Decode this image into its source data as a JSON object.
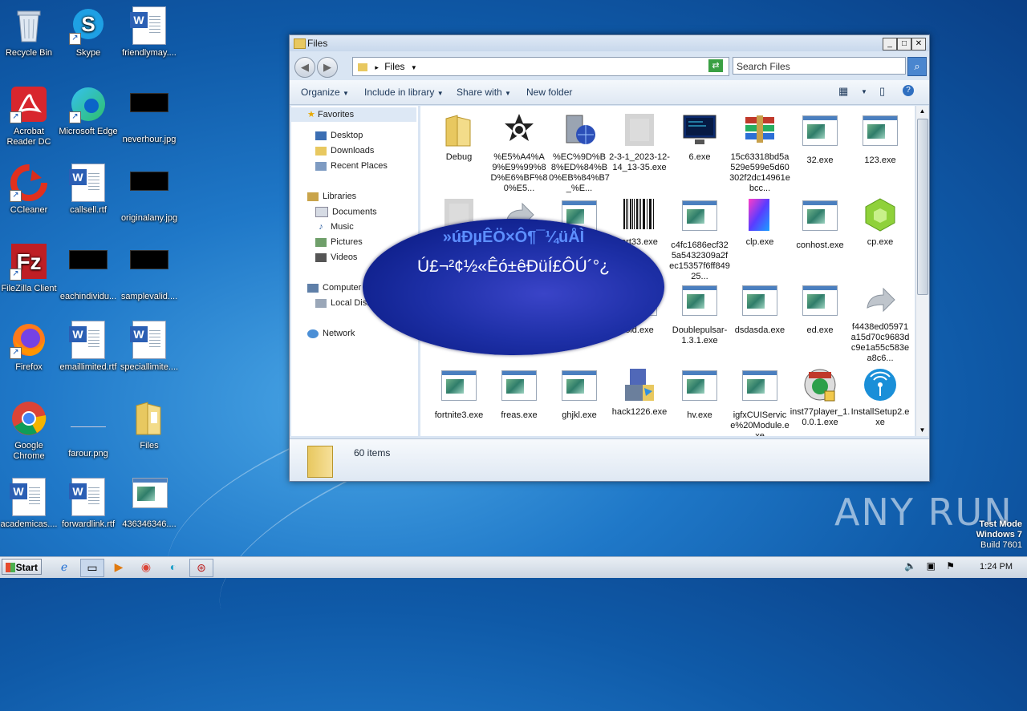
{
  "desktop": {
    "icons": [
      {
        "label": "Recycle Bin",
        "icon": "recycle-bin-icon"
      },
      {
        "label": "Skype",
        "icon": "skype-icon"
      },
      {
        "label": "friendlymay....",
        "icon": "word-doc-icon"
      },
      {
        "label": "Acrobat Reader DC",
        "icon": "acrobat-icon"
      },
      {
        "label": "Microsoft Edge",
        "icon": "edge-icon"
      },
      {
        "label": "neverhour.jpg",
        "icon": "image-file-icon"
      },
      {
        "label": "CCleaner",
        "icon": "ccleaner-icon"
      },
      {
        "label": "callsell.rtf",
        "icon": "word-doc-icon"
      },
      {
        "label": "originalany.jpg",
        "icon": "image-file-icon"
      },
      {
        "label": "FileZilla Client",
        "icon": "filezilla-icon"
      },
      {
        "label": "eachindividu...",
        "icon": "image-file-icon"
      },
      {
        "label": "samplevalid....",
        "icon": "image-file-icon"
      },
      {
        "label": "Firefox",
        "icon": "firefox-icon"
      },
      {
        "label": "emaillimited.rtf",
        "icon": "word-doc-icon"
      },
      {
        "label": "speciallimite....",
        "icon": "word-doc-icon"
      },
      {
        "label": "Google Chrome",
        "icon": "chrome-icon"
      },
      {
        "label": "farour.png",
        "icon": "image-file-icon"
      },
      {
        "label": "Files",
        "icon": "folder-icon"
      },
      {
        "label": "academicas....",
        "icon": "word-doc-icon"
      },
      {
        "label": "forwardlink.rtf",
        "icon": "word-doc-icon"
      },
      {
        "label": "436346346....",
        "icon": "exe-icon"
      }
    ]
  },
  "window": {
    "title": "Files",
    "address": "Files",
    "search_placeholder": "Search Files",
    "toolbar": {
      "organize": "Organize",
      "include": "Include in library",
      "share": "Share with",
      "new_folder": "New folder"
    },
    "nav": {
      "favorites": "Favorites",
      "desktop": "Desktop",
      "downloads": "Downloads",
      "recent": "Recent Places",
      "libraries": "Libraries",
      "documents": "Documents",
      "music": "Music",
      "pictures": "Pictures",
      "videos": "Videos",
      "homegroup": "Homegroup",
      "computer": "Computer",
      "local_disk": "Local Disk (C:)",
      "network": "Network"
    },
    "files": [
      {
        "name": "Debug",
        "icon": "folder-icon"
      },
      {
        "name": "%E5%A4%A9%E9%99%8D%E6%BF%80%E5...",
        "icon": "badge-icon"
      },
      {
        "name": "%EC%9D%B8%ED%84%B0%EB%84%B7_%E...",
        "icon": "globe-server-icon"
      },
      {
        "name": "2-3-1_2023-12-14_13-35.exe",
        "icon": "blurred-icon"
      },
      {
        "name": "6.exe",
        "icon": "terminal-icon"
      },
      {
        "name": "15c63318bd5a529e599e5d60302f2dc14961ebcc...",
        "icon": "winrar-icon"
      },
      {
        "name": "32.exe",
        "icon": "exe-icon"
      },
      {
        "name": "123.exe",
        "icon": "exe-icon"
      },
      {
        "name": "",
        "icon": "blurred-icon"
      },
      {
        "name": "",
        "icon": "shortcut-arrow-icon"
      },
      {
        "name": "",
        "icon": "exe-icon"
      },
      {
        "name": "art33.exe",
        "icon": "barcode-icon"
      },
      {
        "name": "c4fc1686ecf325a5432309a2fec15357f6ff84925...",
        "icon": "exe-icon"
      },
      {
        "name": "clp.exe",
        "icon": "crystal-icon"
      },
      {
        "name": "conhost.exe",
        "icon": "exe-icon"
      },
      {
        "name": "cp.exe",
        "icon": "green-cube-icon"
      },
      {
        "name": "",
        "icon": "exe-icon"
      },
      {
        "name": "",
        "icon": "exe-icon"
      },
      {
        "name": "",
        "icon": "exe-icon"
      },
      {
        "name": "old.exe",
        "icon": "exe-icon"
      },
      {
        "name": "Doublepulsar-1.3.1.exe",
        "icon": "exe-icon"
      },
      {
        "name": "dsdasda.exe",
        "icon": "exe-icon"
      },
      {
        "name": "ed.exe",
        "icon": "exe-icon"
      },
      {
        "name": "f4438ed05971a15d70c9683dc9e1a55c583ea8c6...",
        "icon": "shortcut-arrow-icon"
      },
      {
        "name": "fortnite3.exe",
        "icon": "exe-icon"
      },
      {
        "name": "freas.exe",
        "icon": "exe-icon"
      },
      {
        "name": "ghjkl.exe",
        "icon": "exe-icon"
      },
      {
        "name": "hack1226.exe",
        "icon": "installer-icon"
      },
      {
        "name": "hv.exe",
        "icon": "exe-icon"
      },
      {
        "name": "igfxCUIService%20Module.exe",
        "icon": "exe-icon"
      },
      {
        "name": "inst77player_1.0.0.1.exe",
        "icon": "nsis-icon"
      },
      {
        "name": "InstallSetup2.exe",
        "icon": "wifi-setup-icon"
      }
    ],
    "status": "60 items"
  },
  "overlay": {
    "line1": "»úÐµÊÖ×Ô¶¯¼üÅÌ",
    "line2": "Ú£¬²¢½«Êó±êÐüÍ£ÔÚ´°¿"
  },
  "taskbar": {
    "start": "Start",
    "time": "1:24 PM"
  },
  "watermark": {
    "line1": "Test Mode",
    "line2": "Windows 7",
    "line3": "Build 7601",
    "brand": "ANY RUN"
  },
  "colors": {
    "desktop_bg": "#1f78c8",
    "overlay_bg": "#1d2fa6",
    "overlay_title": "#5d8fff"
  }
}
